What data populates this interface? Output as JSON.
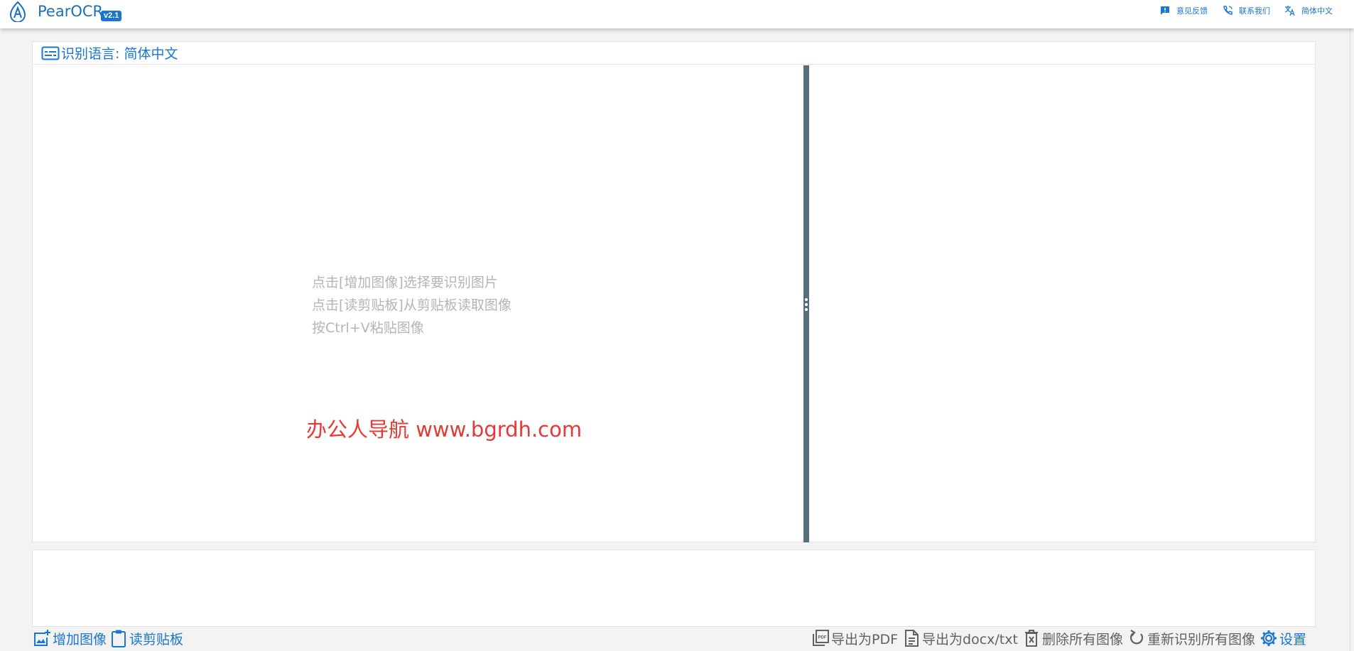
{
  "header": {
    "app_title": "PearOCR",
    "version": "v2.1",
    "feedback_label": "意见反馈",
    "contact_label": "联系我们",
    "language_label": "简体中文"
  },
  "main": {
    "recognition_language": "识别语言: 简体中文",
    "hints": [
      "点击[增加图像]选择要识别图片",
      "点击[读剪贴板]从剪贴板读取图像",
      "按Ctrl+V粘贴图像"
    ],
    "watermark": "办公人导航  www.bgrdh.com"
  },
  "toolbar": {
    "add_image": "增加图像",
    "read_clipboard": "读剪贴板",
    "export_pdf": "导出为PDF",
    "export_docx": "导出为docx/txt",
    "delete_all": "删除所有图像",
    "rerecognize_all": "重新识别所有图像",
    "settings": "设置"
  },
  "colors": {
    "accent": "#1976d2",
    "divider": "#546e7a",
    "watermark": "#e53935",
    "hint": "#b4b4b4"
  }
}
